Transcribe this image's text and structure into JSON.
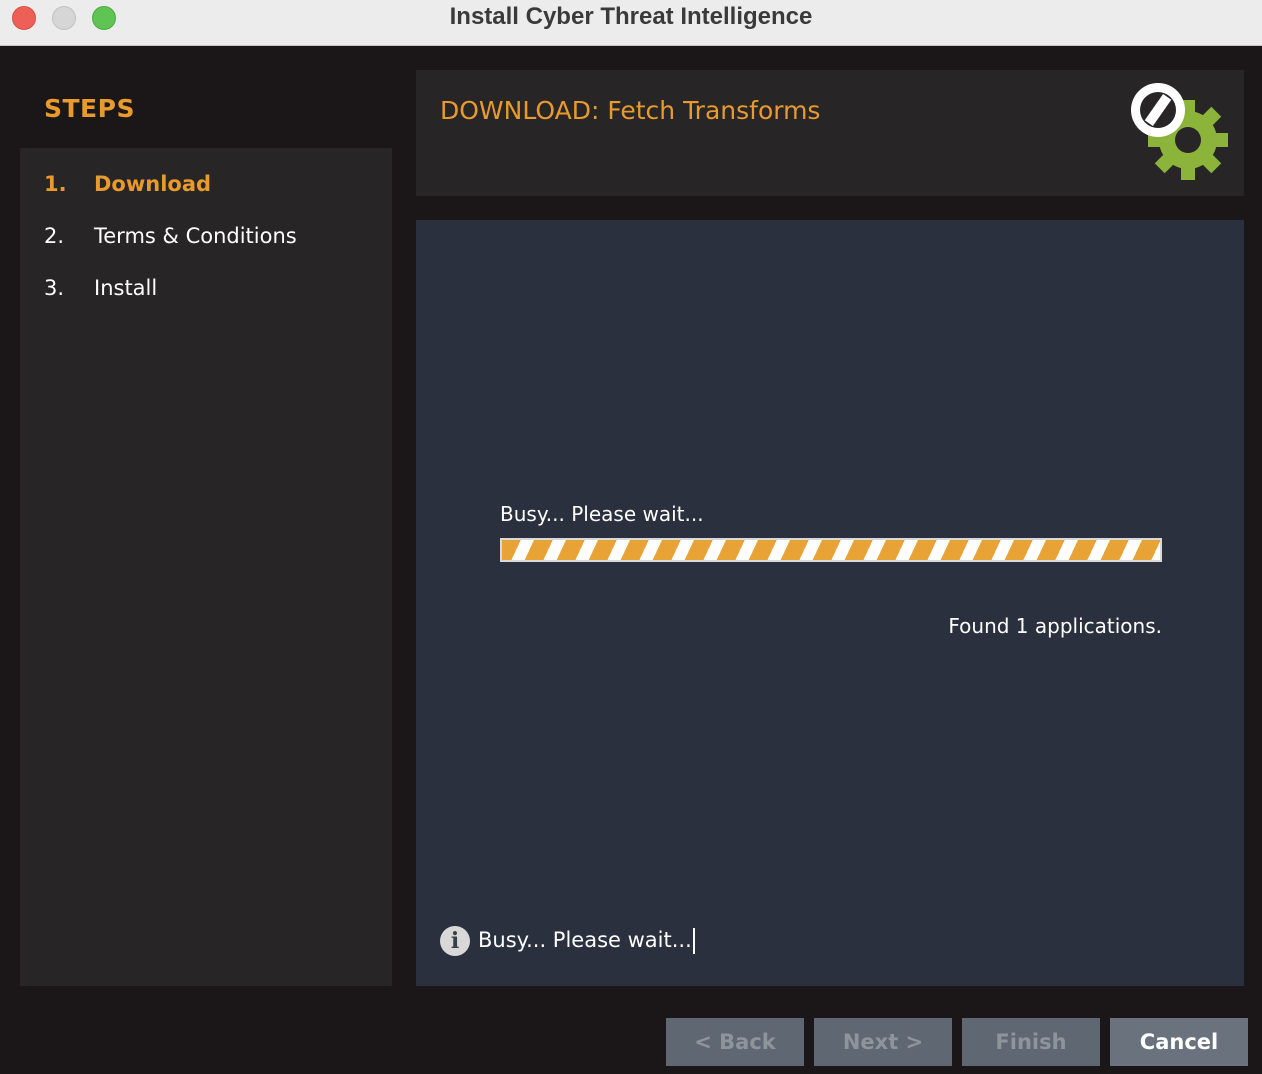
{
  "window": {
    "title": "Install Cyber Threat Intelligence"
  },
  "sidebar": {
    "title": "STEPS",
    "steps": [
      {
        "num": "1.",
        "label": "Download",
        "active": true
      },
      {
        "num": "2.",
        "label": "Terms & Conditions",
        "active": false
      },
      {
        "num": "3.",
        "label": "Install",
        "active": false
      }
    ]
  },
  "header": {
    "title": "DOWNLOAD: Fetch Transforms",
    "logo_icon": "gear-with-disabled-symbol-icon"
  },
  "content": {
    "busy_label": "Busy... Please wait...",
    "progress": {
      "state": "indeterminate",
      "color": "#e8a336"
    },
    "found_text": "Found 1 applications.",
    "status_icon": "info-icon",
    "status_glyph": "i",
    "status_text": "Busy... Please wait..."
  },
  "buttons": {
    "back": "< Back",
    "next": "Next >",
    "finish": "Finish",
    "cancel": "Cancel"
  },
  "colors": {
    "accent": "#e89a2c",
    "panel": "#272526",
    "content_bg": "#2a303d",
    "logo_green": "#8cb33a"
  }
}
